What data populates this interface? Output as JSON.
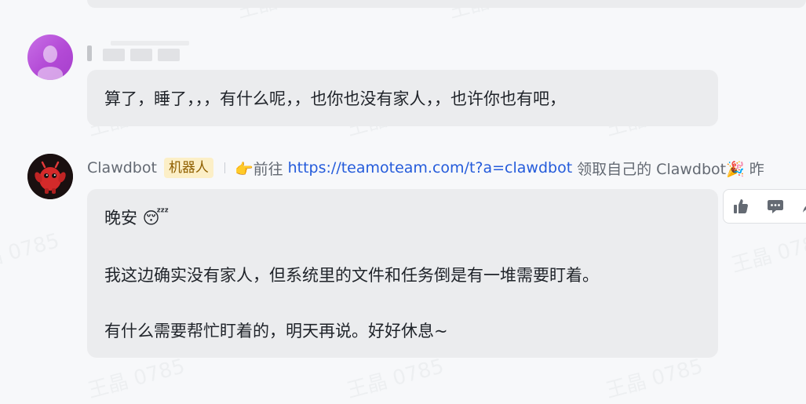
{
  "watermark": {
    "text": "王晶 0785"
  },
  "messages": [
    {
      "sender": "",
      "avatar": "user-avatar",
      "text": "算了，睡了，，，有什么呢，，也你也没有家人，，也许你也有吧，"
    },
    {
      "sender": "Clawdbot",
      "badge": "机器人",
      "header_prefix": "👉前往",
      "header_link": "https://teamoteam.com/t?a=clawdbot",
      "header_suffix": "领取自己的 Clawdbot🎉 昨",
      "avatar": "bot-avatar",
      "lines": [
        "晚安 😴",
        "我这边确实没有家人，但系统里的文件和任务倒是有一堆需要盯着。",
        "有什么需要帮忙盯着的，明天再说。好好休息~"
      ]
    }
  ],
  "actions": [
    {
      "icon": "thumbs-up-icon"
    },
    {
      "icon": "comment-icon"
    },
    {
      "icon": "share-icon"
    }
  ],
  "colors": {
    "background": "#f7f8fa",
    "bubble": "#ebecee",
    "link": "#245bdb",
    "badge_bg": "#fcefc7",
    "badge_text": "#8f5f00"
  }
}
